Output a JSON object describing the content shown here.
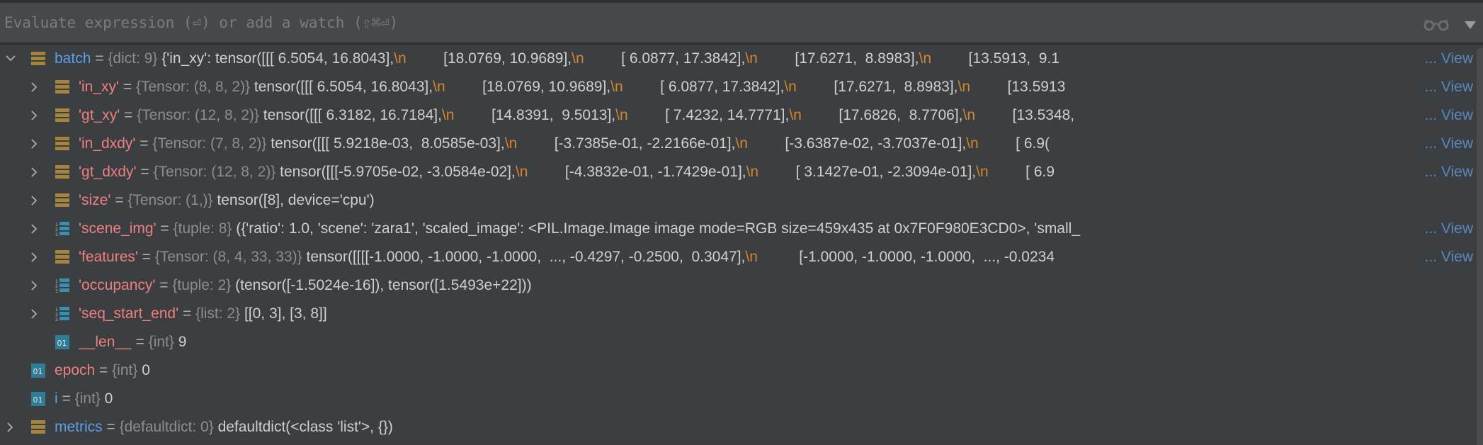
{
  "evaluate": {
    "placeholder": "Evaluate expression (⏎) or add a watch (⇧⌘⏎)",
    "watch_icon": "glasses-icon",
    "dropdown_icon": "triangle-down-icon"
  },
  "colors": {
    "background": "#3c3f41",
    "local_name": "#5c9ee8",
    "changed_name": "#ef7f7f",
    "newline": "#d4862f",
    "link": "#5a86c0"
  },
  "view_label": "View",
  "ellipsis": "...",
  "rows": [
    {
      "name": "batch",
      "type": "{dict: 9}",
      "value": "{'in_xy': tensor([[[ 6.5054, 16.8043],\\n         [18.0769, 10.9689],\\n         [ 6.0877, 17.3842],\\n         [17.6271,  8.8983],\\n         [13.5913,  9.1",
      "icon": "dict-icon",
      "expanded": true,
      "level": 0,
      "name_color": "blue",
      "view": true
    },
    {
      "name": "'in_xy'",
      "type": "{Tensor: (8, 8, 2)}",
      "value": "tensor([[[ 6.5054, 16.8043],\\n         [18.0769, 10.9689],\\n         [ 6.0877, 17.3842],\\n         [17.6271,  8.8983],\\n         [13.5913",
      "icon": "dict-icon",
      "expanded": false,
      "level": 1,
      "name_color": "pink",
      "view": true
    },
    {
      "name": "'gt_xy'",
      "type": "{Tensor: (12, 8, 2)}",
      "value": "tensor([[[ 6.3182, 16.7184],\\n         [14.8391,  9.5013],\\n         [ 7.4232, 14.7771],\\n         [17.6826,  8.7706],\\n         [13.5348,",
      "icon": "dict-icon",
      "expanded": false,
      "level": 1,
      "name_color": "pink",
      "view": true
    },
    {
      "name": "'in_dxdy'",
      "type": "{Tensor: (7, 8, 2)}",
      "value": "tensor([[[ 5.9218e-03,  8.0585e-03],\\n         [-3.7385e-01, -2.2166e-01],\\n         [-3.6387e-02, -3.7037e-01],\\n         [ 6.9(",
      "icon": "dict-icon",
      "expanded": false,
      "level": 1,
      "name_color": "pink",
      "view": true
    },
    {
      "name": "'gt_dxdy'",
      "type": "{Tensor: (12, 8, 2)}",
      "value": "tensor([[[-5.9705e-02, -3.0584e-02],\\n         [-4.3832e-01, -1.7429e-01],\\n         [ 3.1427e-01, -2.3094e-01],\\n         [ 6.9",
      "icon": "dict-icon",
      "expanded": false,
      "level": 1,
      "name_color": "pink",
      "view": true
    },
    {
      "name": "'size'",
      "type": "{Tensor: (1,)}",
      "value": "tensor([8], device='cpu')",
      "icon": "dict-icon",
      "expanded": false,
      "level": 1,
      "name_color": "pink",
      "view": false
    },
    {
      "name": "'scene_img'",
      "type": "{tuple: 8}",
      "value": "({'ratio': 1.0, 'scene': 'zara1', 'scaled_image': <PIL.Image.Image image mode=RGB size=459x435 at 0x7F0F980E3CD0>, 'small_",
      "icon": "list-icon",
      "expanded": false,
      "level": 1,
      "name_color": "pink",
      "view": true
    },
    {
      "name": "'features'",
      "type": "{Tensor: (8, 4, 33, 33)}",
      "value": "tensor([[[[-1.0000, -1.0000, -1.0000,  ..., -0.4297, -0.2500,  0.3047],\\n          [-1.0000, -1.0000, -1.0000,  ..., -0.0234",
      "icon": "dict-icon",
      "expanded": false,
      "level": 1,
      "name_color": "pink",
      "view": true
    },
    {
      "name": "'occupancy'",
      "type": "{tuple: 2}",
      "value": "(tensor([-1.5024e-16]), tensor([1.5493e+22]))",
      "icon": "list-icon",
      "expanded": false,
      "level": 1,
      "name_color": "pink",
      "view": false
    },
    {
      "name": "'seq_start_end'",
      "type": "{list: 2}",
      "value": "[[0, 3], [3, 8]]",
      "icon": "list-icon",
      "expanded": false,
      "level": 1,
      "name_color": "pink",
      "view": false
    },
    {
      "name": "__len__",
      "type": "{int}",
      "value": "9",
      "icon": "int-icon",
      "expanded": null,
      "level": 1,
      "name_color": "pink",
      "view": false
    },
    {
      "name": "epoch",
      "type": "{int}",
      "value": "0",
      "icon": "int-icon",
      "expanded": null,
      "level": 0,
      "name_color": "pink",
      "view": false
    },
    {
      "name": "i",
      "type": "{int}",
      "value": "0",
      "icon": "int-icon",
      "expanded": null,
      "level": 0,
      "name_color": "blue",
      "view": false
    },
    {
      "name": "metrics",
      "type": "{defaultdict: 0}",
      "value": "defaultdict(<class 'list'>, {})",
      "icon": "dict-icon",
      "expanded": false,
      "level": 0,
      "name_color": "blue",
      "view": false
    }
  ]
}
